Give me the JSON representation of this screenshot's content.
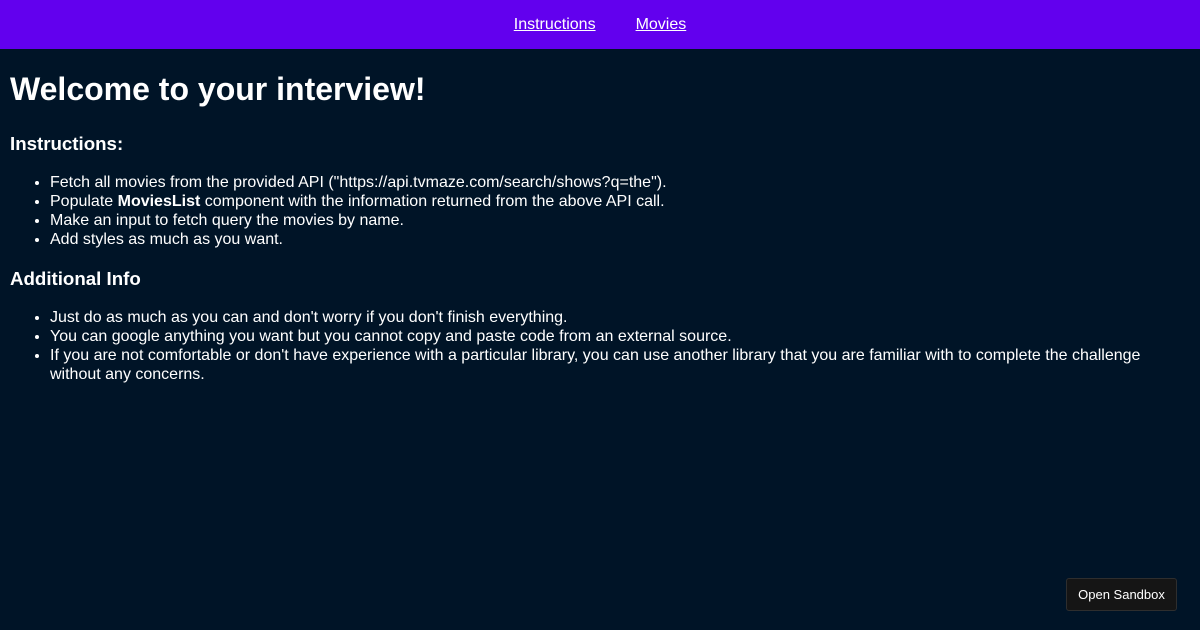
{
  "nav": {
    "links": [
      "Instructions",
      "Movies"
    ]
  },
  "page": {
    "title": "Welcome to your interview!",
    "instructions_heading": "Instructions:",
    "instructions": [
      {
        "pre": "Fetch all movies from the provided API (\"https://api.tvmaze.com/search/shows?q=the\").",
        "bold": "",
        "post": ""
      },
      {
        "pre": "Populate ",
        "bold": "MoviesList",
        "post": " component with the information returned from the above API call."
      },
      {
        "pre": "Make an input to fetch query the movies by name.",
        "bold": "",
        "post": ""
      },
      {
        "pre": "Add styles as much as you want.",
        "bold": "",
        "post": ""
      }
    ],
    "info_heading": "Additional Info",
    "info": [
      "Just do as much as you can and don't worry if you don't finish everything.",
      "You can google anything you want but you cannot copy and paste code from an external source.",
      "If you are not comfortable or don't have experience with a particular library, you can use another library that you are familiar with to complete the challenge without any concerns."
    ]
  },
  "sandbox_button": {
    "label": "Open Sandbox"
  },
  "colors": {
    "nav_bg": "#6200ee",
    "page_bg": "#001427",
    "button_bg": "#151515"
  }
}
